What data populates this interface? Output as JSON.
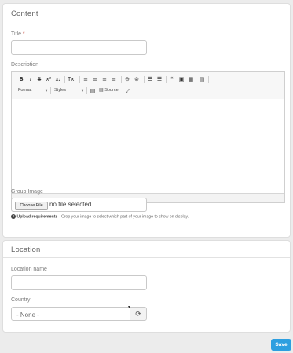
{
  "content_section": {
    "heading": "Content",
    "title_label": "Title",
    "required_mark": "*",
    "title_value": "",
    "description_label": "Description",
    "editor": {
      "buttons": [
        {
          "name": "bold-button",
          "glyph": "B"
        },
        {
          "name": "italic-button",
          "glyph": "I"
        },
        {
          "name": "strikethrough-button",
          "glyph": "S"
        },
        {
          "name": "superscript-button",
          "glyph": "x²"
        },
        {
          "name": "subscript-button",
          "glyph": "x₂"
        },
        {
          "name": "remove-format-button",
          "glyph": "Tx"
        },
        {
          "name": "align-left-button",
          "glyph": "≡"
        },
        {
          "name": "align-center-button",
          "glyph": "≡"
        },
        {
          "name": "align-right-button",
          "glyph": "≡"
        },
        {
          "name": "justify-button",
          "glyph": "≡"
        },
        {
          "name": "link-button",
          "glyph": "⊖"
        },
        {
          "name": "unlink-button",
          "glyph": "⊘"
        },
        {
          "name": "bulleted-list-button",
          "glyph": "☰"
        },
        {
          "name": "numbered-list-button",
          "glyph": "☰"
        },
        {
          "name": "blockquote-button",
          "glyph": "❝"
        },
        {
          "name": "image-button",
          "glyph": "▣"
        },
        {
          "name": "table-button",
          "glyph": "▦"
        },
        {
          "name": "horizontal-rule-button",
          "glyph": "▤"
        }
      ],
      "format_label": "Format",
      "styles_label": "Styles",
      "paste_button": "▤",
      "source_label": "Source",
      "maximize_button": "⤢"
    },
    "group_image_label": "Group Image",
    "choose_file_label": "Choose File",
    "no_file_text": "no file selected",
    "upload_help_bold": "Upload requirements",
    "upload_help_text": " - Crop your image to select which part of your image to show on display."
  },
  "location_section": {
    "heading": "Location",
    "location_name_label": "Location name",
    "location_name_value": "",
    "country_label": "Country",
    "country_selected": "- None -"
  },
  "footer": {
    "save_label": "Save"
  },
  "colors": {
    "accent": "#2d9fe0",
    "required": "#c0392b",
    "background": "#ececec"
  }
}
